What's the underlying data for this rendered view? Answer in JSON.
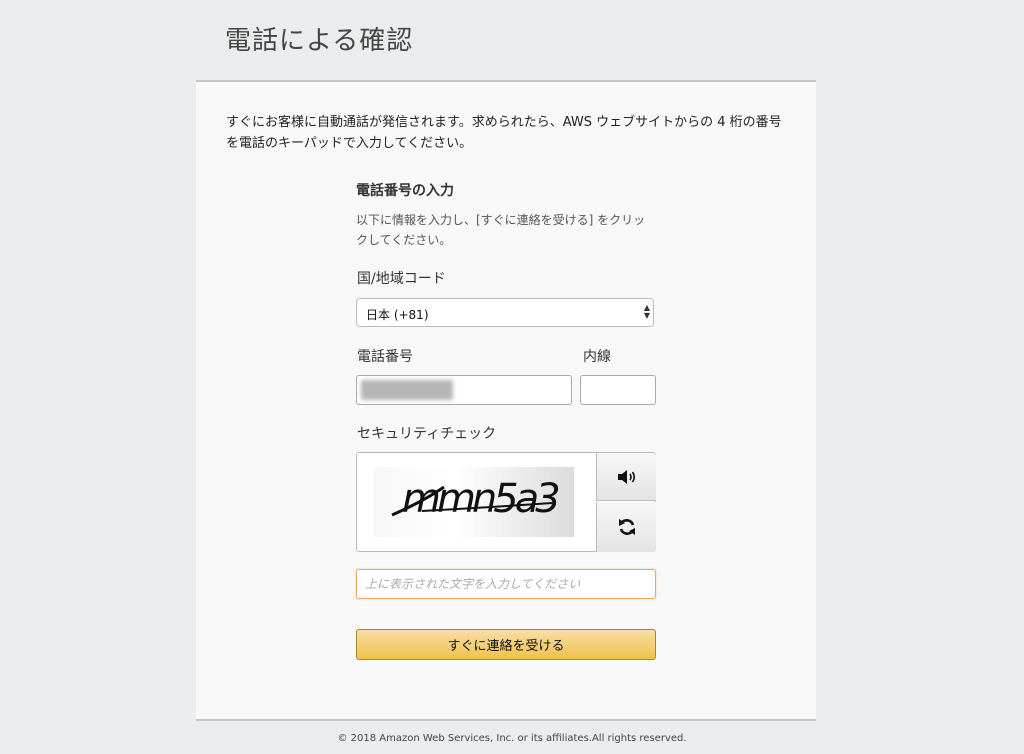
{
  "header": {
    "title": "電話による確認"
  },
  "intro": {
    "text": "すぐにお客様に自動通話が発信されます。求められたら、AWS ウェブサイトからの 4 桁の番号を電話のキーパッドで入力してください。"
  },
  "form": {
    "section_title": "電話番号の入力",
    "section_desc": "以下に情報を入力し、[すぐに連絡を受ける] をクリックしてください。",
    "country_label": "国/地域コード",
    "country_value": "日本 (+81)",
    "phone_label": "電話番号",
    "extension_label": "内線",
    "security_label": "セキュリティチェック",
    "captcha_text": "mmn5a3",
    "captcha_placeholder": "上に表示された文字を入力してください",
    "submit_label": "すぐに連絡を受ける"
  },
  "icons": {
    "audio": "speaker-icon",
    "refresh": "refresh-icon",
    "select_arrow": "sort-arrows-icon"
  },
  "colors": {
    "button": "#f0c14b",
    "input_focus": "#e5a96a",
    "page_bg": "#eaeded"
  },
  "footer": {
    "copyright": "© 2018 Amazon Web Services, Inc. or its affiliates.All rights reserved."
  }
}
